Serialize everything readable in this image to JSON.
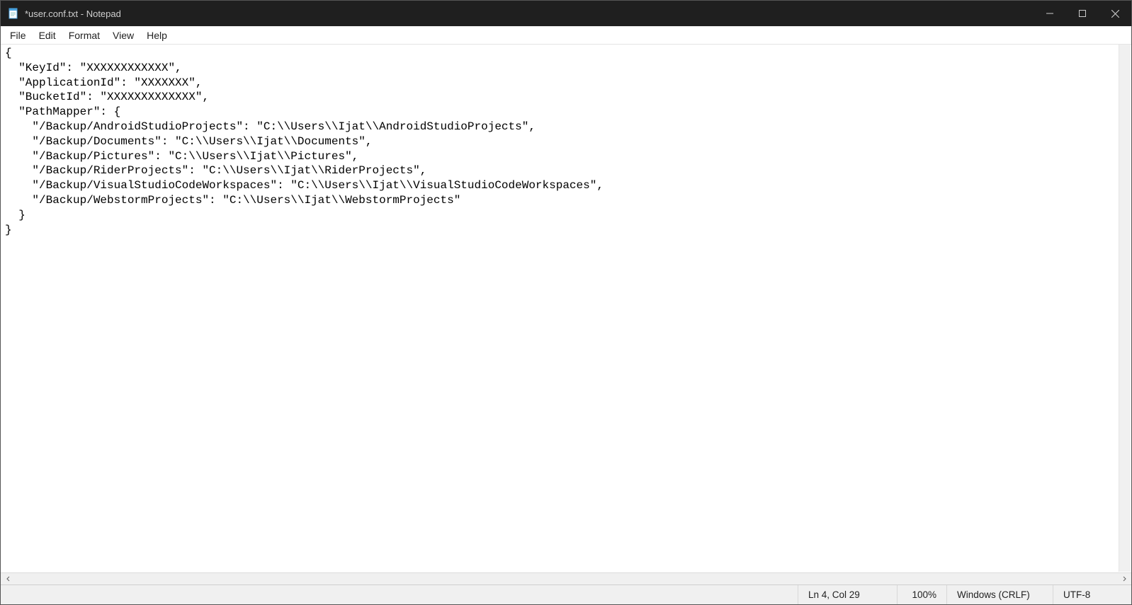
{
  "titlebar": {
    "title": "*user.conf.txt - Notepad"
  },
  "menu": {
    "file": "File",
    "edit": "Edit",
    "format": "Format",
    "view": "View",
    "help": "Help"
  },
  "editor": {
    "content": "{\n  \"KeyId\": \"XXXXXXXXXXXX\",\n  \"ApplicationId\": \"XXXXXXX\",\n  \"BucketId\": \"XXXXXXXXXXXXX\",\n  \"PathMapper\": {\n    \"/Backup/AndroidStudioProjects\": \"C:\\\\Users\\\\Ijat\\\\AndroidStudioProjects\",\n    \"/Backup/Documents\": \"C:\\\\Users\\\\Ijat\\\\Documents\",\n    \"/Backup/Pictures\": \"C:\\\\Users\\\\Ijat\\\\Pictures\",\n    \"/Backup/RiderProjects\": \"C:\\\\Users\\\\Ijat\\\\RiderProjects\",\n    \"/Backup/VisualStudioCodeWorkspaces\": \"C:\\\\Users\\\\Ijat\\\\VisualStudioCodeWorkspaces\",\n    \"/Backup/WebstormProjects\": \"C:\\\\Users\\\\Ijat\\\\WebstormProjects\"\n  }\n}"
  },
  "status": {
    "position": "Ln 4, Col 29",
    "zoom": "100%",
    "eol": "Windows (CRLF)",
    "encoding": "UTF-8"
  }
}
